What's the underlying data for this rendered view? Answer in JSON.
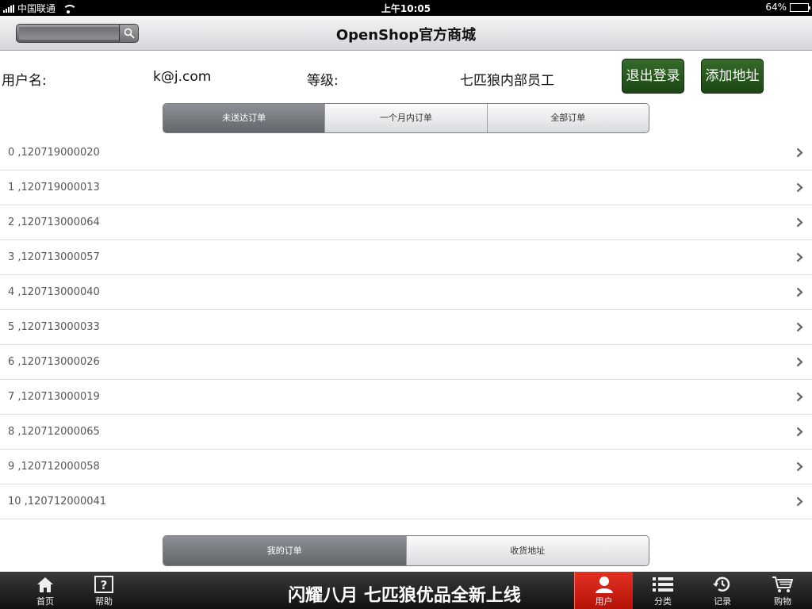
{
  "status_bar": {
    "carrier": "中国联通",
    "time": "上午10:05",
    "battery": "64%",
    "battery_level": 0.64
  },
  "nav": {
    "title": "OpenShop官方商城",
    "search_placeholder": ""
  },
  "user": {
    "username_label": "用户名:",
    "username_value": "k@j.com",
    "level_label": "等级:",
    "level_value": "七匹狼内部员工",
    "logout_label": "退出登录",
    "add_address_label": "添加地址"
  },
  "order_filter": {
    "tabs": [
      "未送达订单",
      "一个月内订单",
      "全部订单"
    ],
    "selected": 0
  },
  "orders": [
    "0 ,120719000020",
    "1 ,120719000013",
    "2 ,120713000064",
    "3 ,120713000057",
    "4 ,120713000040",
    "5 ,120713000033",
    "6 ,120713000026",
    "7 ,120713000019",
    "8 ,120712000065",
    "9 ,120712000058",
    "10 ,120712000041"
  ],
  "bottom_segment": {
    "tabs": [
      "我的订单",
      "收货地址"
    ],
    "selected": 0
  },
  "tab_bar": {
    "promo": "闪耀八月 七匹狼优品全新上线",
    "items": [
      {
        "label": "首页",
        "icon": "home-icon"
      },
      {
        "label": "帮助",
        "icon": "help-icon"
      },
      {
        "label": "用户",
        "icon": "user-icon"
      },
      {
        "label": "分类",
        "icon": "list-icon"
      },
      {
        "label": "记录",
        "icon": "history-icon"
      },
      {
        "label": "购物",
        "icon": "cart-icon"
      }
    ],
    "active_index": 2
  },
  "colors": {
    "green_button": "#1f4a17",
    "active_tab": "#d52516",
    "segment_active": "#6d7074"
  }
}
